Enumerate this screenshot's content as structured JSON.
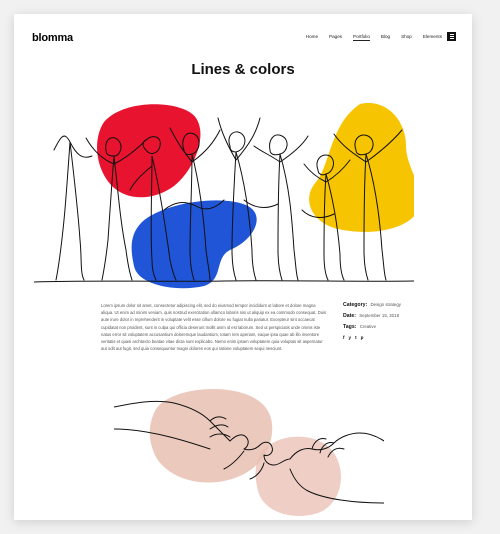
{
  "header": {
    "logo": "blomma",
    "nav": [
      "Home",
      "Pages",
      "Portfolio",
      "Blog",
      "Shop",
      "Elements"
    ],
    "active_nav": "Portfolio",
    "menu_icon": "hamburger-icon"
  },
  "main": {
    "title": "Lines & colors",
    "description": "Lorem ipsum dolor sit amet, consectetur adipiscing elit, sed do eiusmod tempor incididunt ut labore et dolore magna aliqua. Ut enim ad minim veniam, quis nostrud exercitation ullamco laboris nisi ut aliquip ex ea commodo consequat. Duis aute irure dolor in reprehenderit in voluptate velit esse cillum dolore eu fugiat nulla pariatur. Excepteur sint occaecat cupidatat non proident, sunt in culpa qui officia deserunt mollit anim id est laborum. Sed ut perspiciatis unde omnis iste natus error sit voluptatem accusantium doloremque laudantium, totam rem aperiam, eaque ipsa quae ab illo inventore veritatis et quasi architecto beatae vitae dicta sunt explicabo. Nemo enim ipsam voluptatem quia voluptas sit aspernatur aut odit aut fugit, sed quia consequuntur magni dolores eos qui ratione voluptatem sequi nesciunt."
  },
  "meta": {
    "category_label": "Category:",
    "category_value": "Design strategy",
    "date_label": "Date:",
    "date_value": "September 15, 2018",
    "tags_label": "Tags:",
    "tags_value": "Creative",
    "social": [
      "f",
      "y",
      "t",
      "p"
    ]
  },
  "colors": {
    "red": "#e8132f",
    "blue": "#1f55d6",
    "yellow": "#f6c400",
    "pink": "#e9bfb2"
  }
}
